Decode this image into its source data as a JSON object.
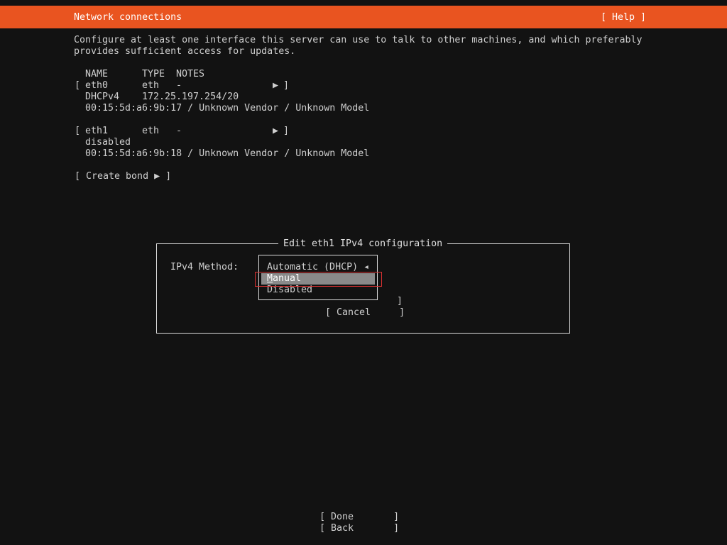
{
  "header": {
    "title": "Network connections",
    "help_label": "[ Help ]"
  },
  "intro": {
    "line1": "Configure at least one interface this server can use to talk to other machines, and which preferably",
    "line2": "provides sufficient access for updates."
  },
  "table": {
    "col_name": "NAME",
    "col_type": "TYPE",
    "col_notes": "NOTES"
  },
  "interfaces": [
    {
      "open_bracket": "[",
      "name": "eth0",
      "type": "eth",
      "notes": "-",
      "arrow": "▶",
      "close_bracket": "]",
      "status": "DHCPv4",
      "address": "172.25.197.254/20",
      "hw": "00:15:5d:a6:9b:17 / Unknown Vendor / Unknown Model"
    },
    {
      "open_bracket": "[",
      "name": "eth1",
      "type": "eth",
      "notes": "-",
      "arrow": "▶",
      "close_bracket": "]",
      "status": "disabled",
      "address": "",
      "hw": "00:15:5d:a6:9b:18 / Unknown Vendor / Unknown Model"
    }
  ],
  "create_bond": "[ Create bond ▶ ]",
  "dialog": {
    "title": "Edit eth1 IPv4 configuration",
    "method_label": "IPv4 Method:",
    "dropdown": {
      "current": "Automatic (DHCP) ◂",
      "options": [
        "Manual",
        "Disabled"
      ],
      "selected_first_letter": "M",
      "selected_rest": "anual"
    },
    "save_bracket": "]",
    "cancel_label": "[ Cancel     ]"
  },
  "footer": {
    "done_label": "[ Done       ]",
    "back_label": "[ Back       ]"
  },
  "colors": {
    "accent": "#e95420",
    "background": "#121212",
    "selection": "#8a8a8a",
    "highlight_border": "#d83131"
  }
}
